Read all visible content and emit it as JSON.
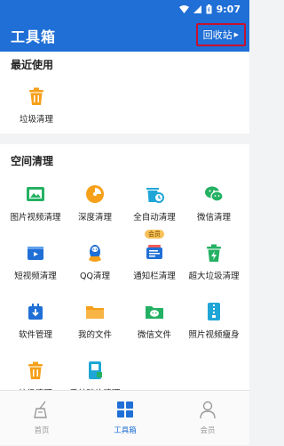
{
  "status_bar": {
    "time": "9:07"
  },
  "app_bar": {
    "title": "工具箱",
    "recycle_label": "回收站"
  },
  "recent": {
    "title": "最近使用",
    "items": [
      {
        "label": "垃圾清理",
        "icon": "trash-icon"
      }
    ]
  },
  "space": {
    "title": "空间清理",
    "vip_label": "会员",
    "items": [
      {
        "label": "图片视频清理",
        "icon": "photo-video-icon"
      },
      {
        "label": "深度清理",
        "icon": "deep-clean-icon"
      },
      {
        "label": "全自动清理",
        "icon": "auto-clean-icon"
      },
      {
        "label": "微信清理",
        "icon": "wechat-icon"
      },
      {
        "label": "短视频清理",
        "icon": "short-video-icon"
      },
      {
        "label": "QQ清理",
        "icon": "qq-icon"
      },
      {
        "label": "通知栏清理",
        "icon": "notification-icon"
      },
      {
        "label": "超大垃圾清理",
        "icon": "large-junk-icon"
      },
      {
        "label": "软件管理",
        "icon": "app-manage-icon"
      },
      {
        "label": "我的文件",
        "icon": "folder-icon"
      },
      {
        "label": "微信文件",
        "icon": "wechat-file-icon"
      },
      {
        "label": "照片视频瘦身",
        "icon": "compress-icon"
      },
      {
        "label": "垃圾清理",
        "icon": "trash-icon"
      },
      {
        "label": "系统碎片清理",
        "icon": "fragment-icon"
      }
    ]
  },
  "tabs": [
    {
      "label": "首页",
      "icon": "home-icon"
    },
    {
      "label": "工具箱",
      "icon": "toolbox-icon",
      "active": true
    },
    {
      "label": "会员",
      "icon": "member-icon"
    }
  ],
  "colors": {
    "primary": "#1f6fd6",
    "orange": "#f6a01a",
    "green": "#25b163",
    "cyan": "#1fa6d6",
    "vip": "#f7c25a"
  }
}
